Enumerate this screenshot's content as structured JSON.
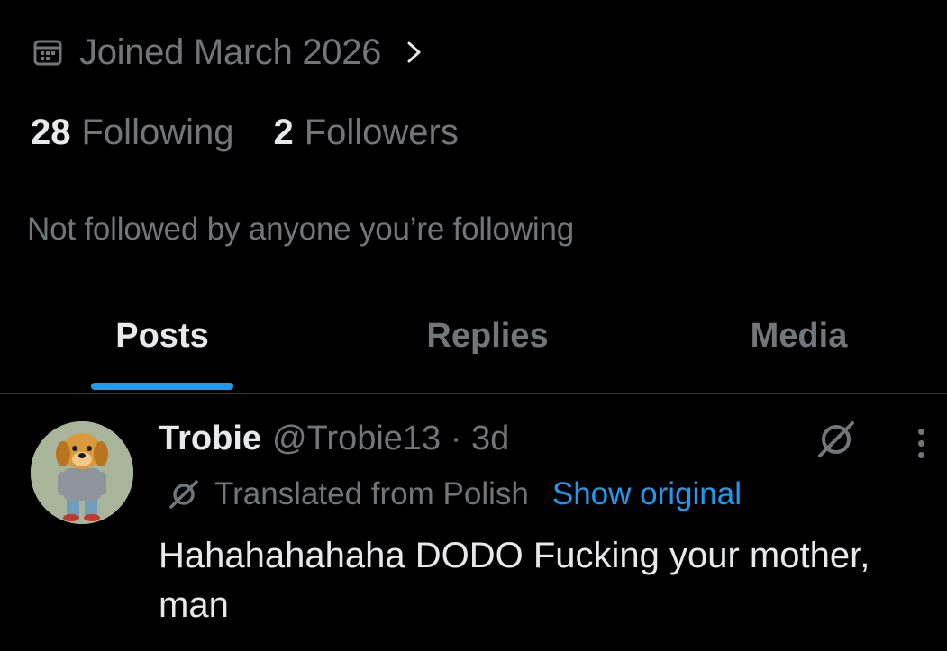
{
  "profile": {
    "joined_text": "Joined March 2026",
    "following_count": "28",
    "following_label": "Following",
    "followers_count": "2",
    "followers_label": "Followers",
    "not_followed_text": "Not followed by anyone you’re following"
  },
  "tabs": [
    {
      "label": "Posts",
      "active": true
    },
    {
      "label": "Replies",
      "active": false
    },
    {
      "label": "Media",
      "active": false
    }
  ],
  "post": {
    "author_name": "Trobie",
    "handle_time": "@Trobie13 · 3d",
    "translated_text": "Translated from Polish",
    "show_original_label": "Show original",
    "body": "Hahahahahaha DODO Fucking your mother, man"
  },
  "colors": {
    "accent": "#1d9bf0",
    "muted": "#71767b",
    "text": "#e7e9ea",
    "background": "#000000"
  },
  "icons": [
    "calendar-icon",
    "chevron-right-icon",
    "grok-icon",
    "more-icon",
    "translate-icon"
  ]
}
